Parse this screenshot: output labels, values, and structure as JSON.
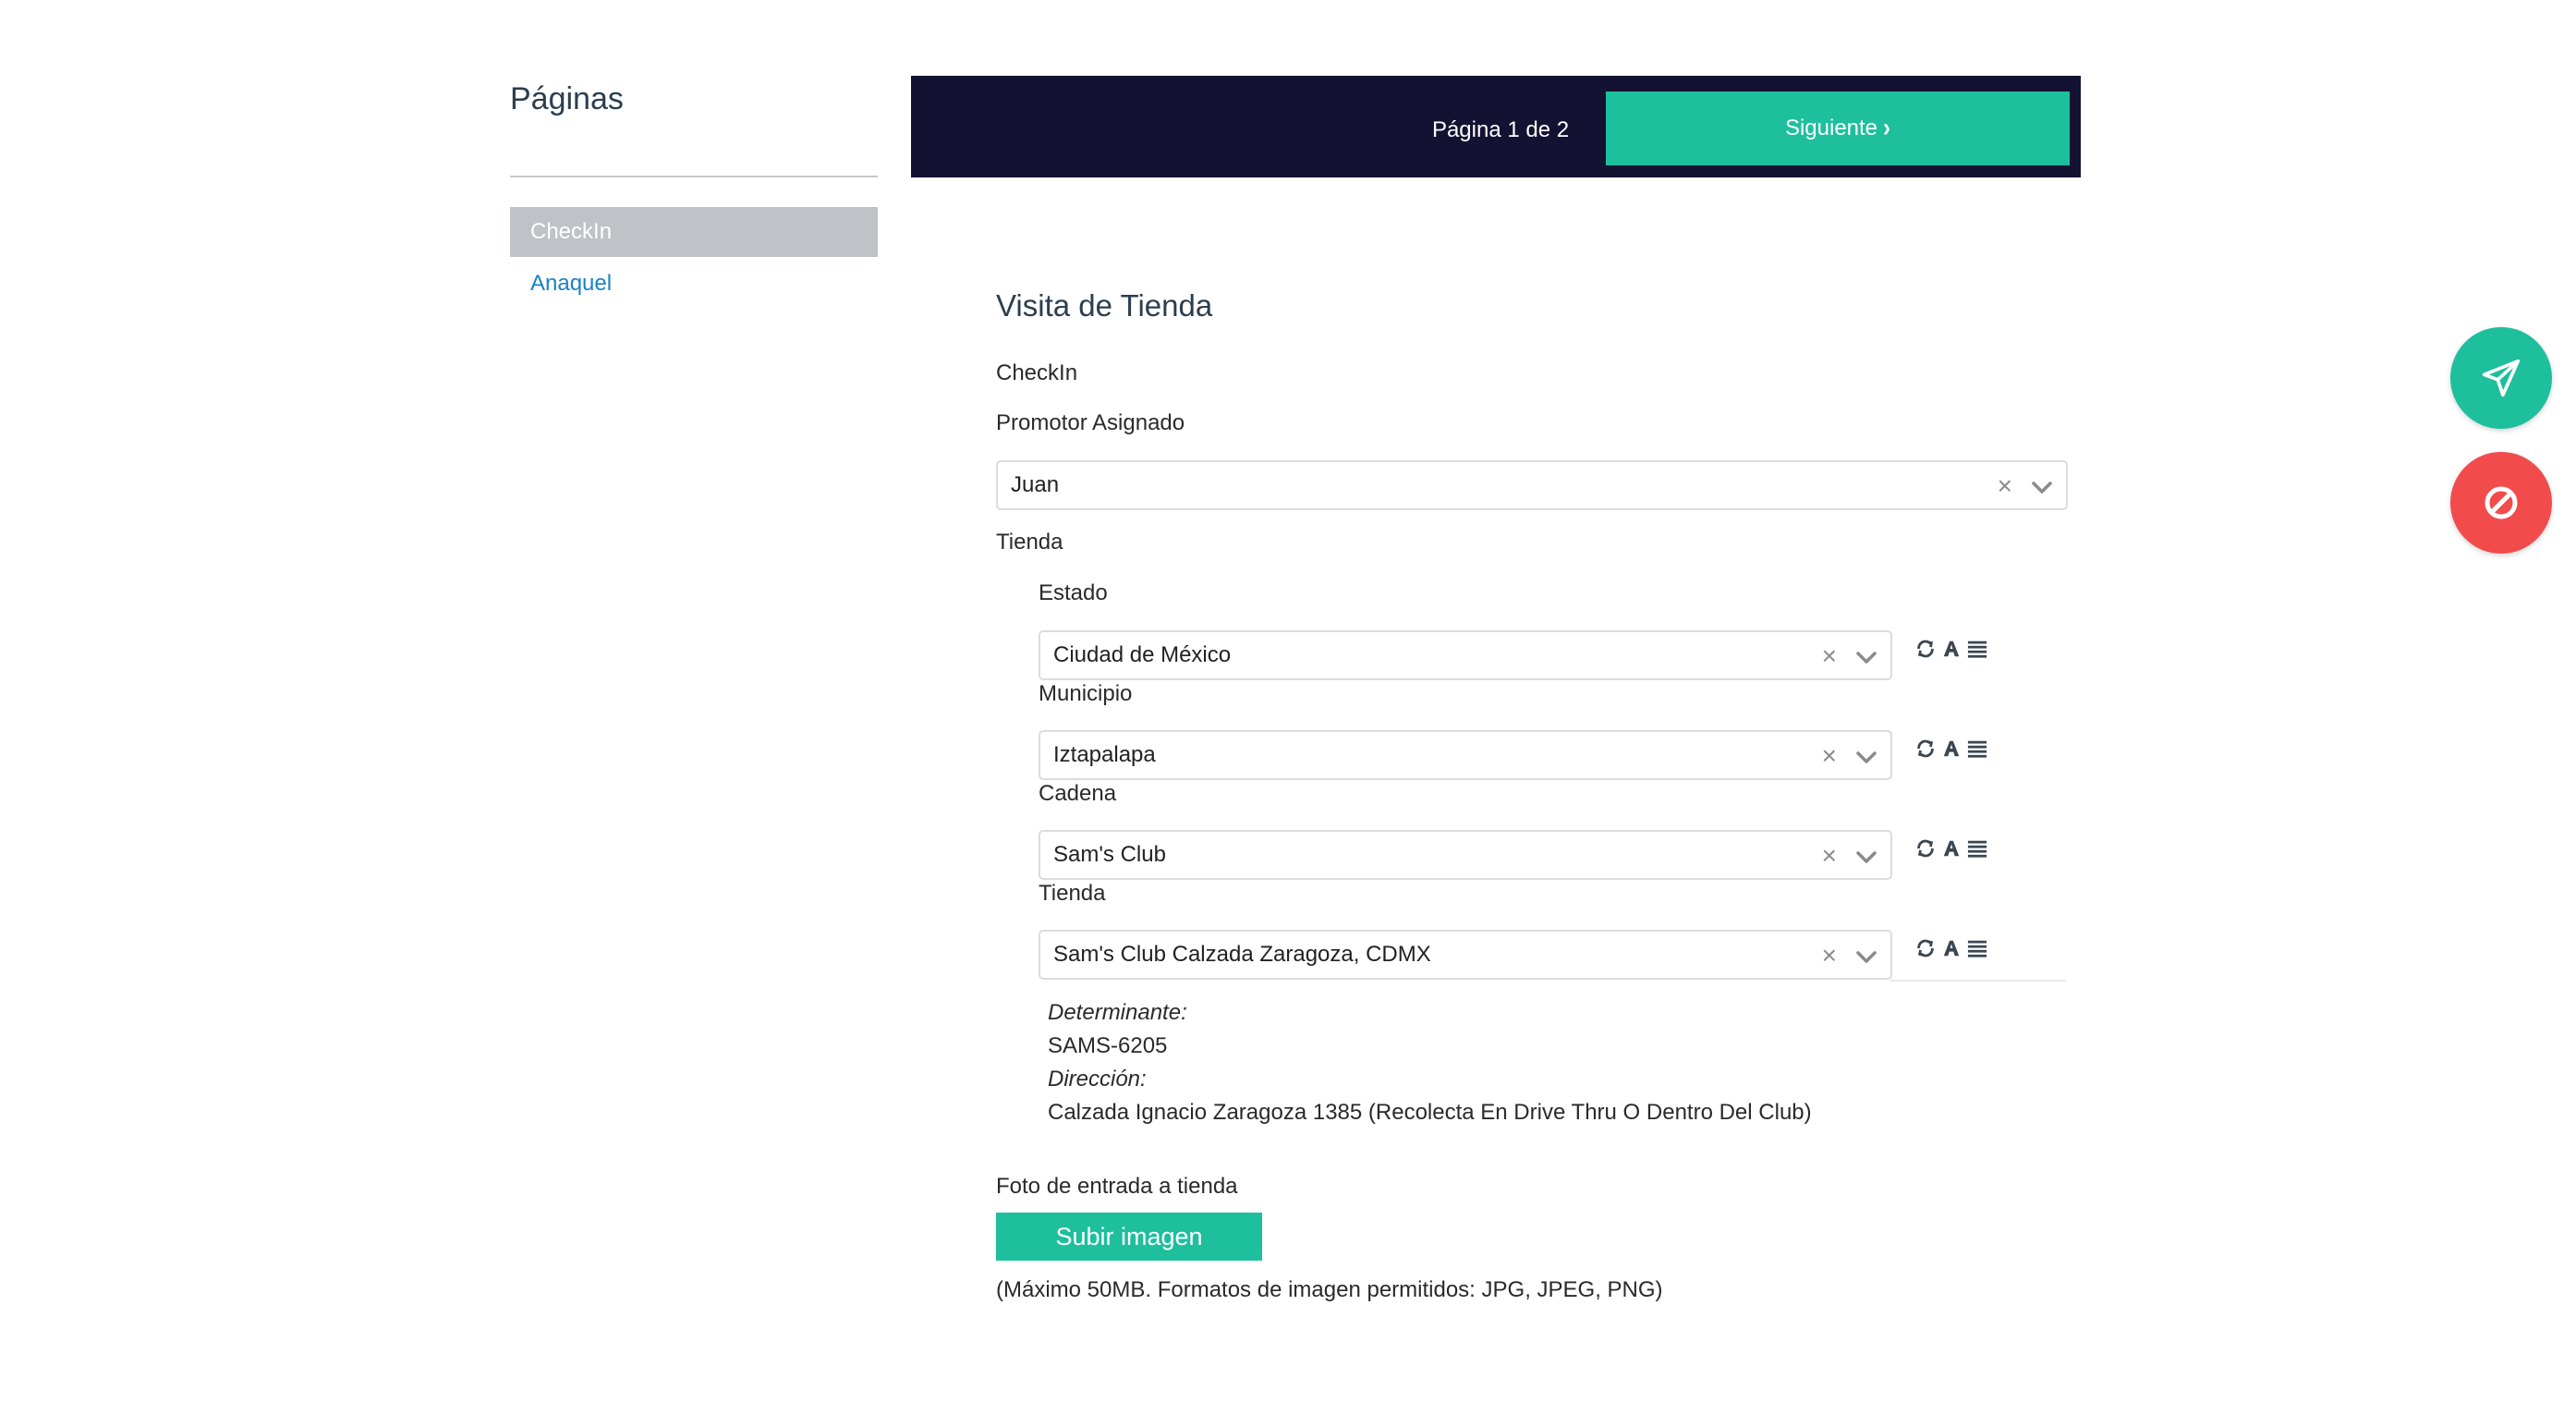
{
  "sidebar": {
    "title": "Páginas",
    "items": [
      {
        "label": "CheckIn",
        "active": true
      },
      {
        "label": "Anaquel",
        "active": false
      }
    ]
  },
  "topbar": {
    "page_indicator": "Página 1 de 2",
    "next_label": "Siguiente"
  },
  "form": {
    "title": "Visita de Tienda",
    "section_label": "CheckIn",
    "promotor_label": "Promotor Asignado",
    "promotor_value": "Juan",
    "tienda_group_label": "Tienda",
    "estado_label": "Estado",
    "estado_value": "Ciudad de México",
    "municipio_label": "Municipio",
    "municipio_value": "Iztapalapa",
    "cadena_label": "Cadena",
    "cadena_value": "Sam's Club",
    "tienda_label": "Tienda",
    "tienda_value": "Sam's Club Calzada Zaragoza, CDMX",
    "determinante_label": "Determinante:",
    "determinante_value": "SAMS-6205",
    "direccion_label": "Dirección:",
    "direccion_value": "Calzada Ignacio Zaragoza 1385 (Recolecta En Drive Thru O Dentro Del Club)",
    "foto_label": "Foto de entrada a tienda",
    "upload_label": "Subir imagen",
    "upload_hint": "(Máximo 50MB. Formatos de imagen permitidos: JPG, JPEG, PNG)"
  },
  "icons": {
    "clear": "×",
    "refresh": "refresh-icon",
    "font": "font-icon",
    "list": "list-icon",
    "chevron": "chevron-down-icon",
    "send": "paper-plane-icon",
    "cancel": "ban-icon"
  },
  "colors": {
    "accent": "#1dbf9d",
    "topbar": "#141233",
    "danger": "#f24b4b",
    "link": "#1a82c4",
    "active_item": "#bfc2c6"
  }
}
